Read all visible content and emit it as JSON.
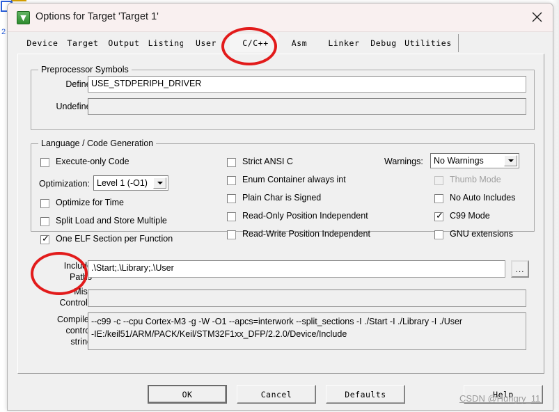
{
  "window": {
    "title": "Options for Target 'Target 1'",
    "icon": "keil-uvision-icon",
    "close_label": "×"
  },
  "tabs": [
    {
      "label": "Device",
      "selected": false
    },
    {
      "label": "Target",
      "selected": false
    },
    {
      "label": "Output",
      "selected": false
    },
    {
      "label": "Listing",
      "selected": false
    },
    {
      "label": "User",
      "selected": false
    },
    {
      "label": "C/C++",
      "selected": true
    },
    {
      "label": "Asm",
      "selected": false
    },
    {
      "label": "Linker",
      "selected": false
    },
    {
      "label": "Debug",
      "selected": false
    },
    {
      "label": "Utilities",
      "selected": false
    }
  ],
  "preprocessor": {
    "group_label": "Preprocessor Symbols",
    "define_label": "Define:",
    "define_value": "USE_STDPERIPH_DRIVER",
    "undefine_label": "Undefine:",
    "undefine_value": ""
  },
  "language": {
    "group_label": "Language / Code Generation",
    "left_column": [
      {
        "label": "Execute-only Code",
        "checked": false,
        "disabled": false
      },
      {
        "label": "Optimize for Time",
        "checked": false,
        "disabled": false
      },
      {
        "label": "Split Load and Store Multiple",
        "checked": false,
        "disabled": false
      },
      {
        "label": "One ELF Section per Function",
        "checked": true,
        "disabled": false
      }
    ],
    "optimization_label": "Optimization:",
    "optimization_value": "Level 1 (-O1)",
    "middle_column": [
      {
        "label": "Strict ANSI C",
        "checked": false,
        "disabled": false
      },
      {
        "label": "Enum Container always int",
        "checked": false,
        "disabled": false
      },
      {
        "label": "Plain Char is Signed",
        "checked": false,
        "disabled": false
      },
      {
        "label": "Read-Only Position Independent",
        "checked": false,
        "disabled": false
      },
      {
        "label": "Read-Write Position Independent",
        "checked": false,
        "disabled": false
      }
    ],
    "warnings_label": "Warnings:",
    "warnings_value": "No Warnings",
    "right_column": [
      {
        "label": "Thumb Mode",
        "checked": false,
        "disabled": true
      },
      {
        "label": "No Auto Includes",
        "checked": false,
        "disabled": false
      },
      {
        "label": "C99 Mode",
        "checked": true,
        "disabled": false
      },
      {
        "label": "GNU extensions",
        "checked": false,
        "disabled": false
      }
    ]
  },
  "paths": {
    "include_label_line1": "Include",
    "include_label_line2": "Paths",
    "include_value": ".\\Start;.\\Library;.\\User",
    "browse_label": "...",
    "misc_label_line1": "Misc",
    "misc_label_line2": "Controls",
    "misc_value": "",
    "compiler_label_line1": "Compiler",
    "compiler_label_line2": "control",
    "compiler_label_line3": "string",
    "compiler_value_line1": "--c99 -c --cpu Cortex-M3 -g -W -O1 --apcs=interwork --split_sections -I ./Start -I ./Library -I ./User",
    "compiler_value_line2": "-IE:/keil51/ARM/PACK/Keil/STM32F1xx_DFP/2.2.0/Device/Include"
  },
  "buttons": {
    "ok": "OK",
    "cancel": "Cancel",
    "defaults": "Defaults",
    "help": "Help"
  },
  "watermark": "CSDN @Hungry_11",
  "background_window": {
    "line_number": "2"
  },
  "colors": {
    "annotation": "#e21b1b",
    "dialog_bg": "#f0f0f0",
    "titlebar_bg": "#f9f0f0",
    "field_bg": "#ffffff"
  }
}
